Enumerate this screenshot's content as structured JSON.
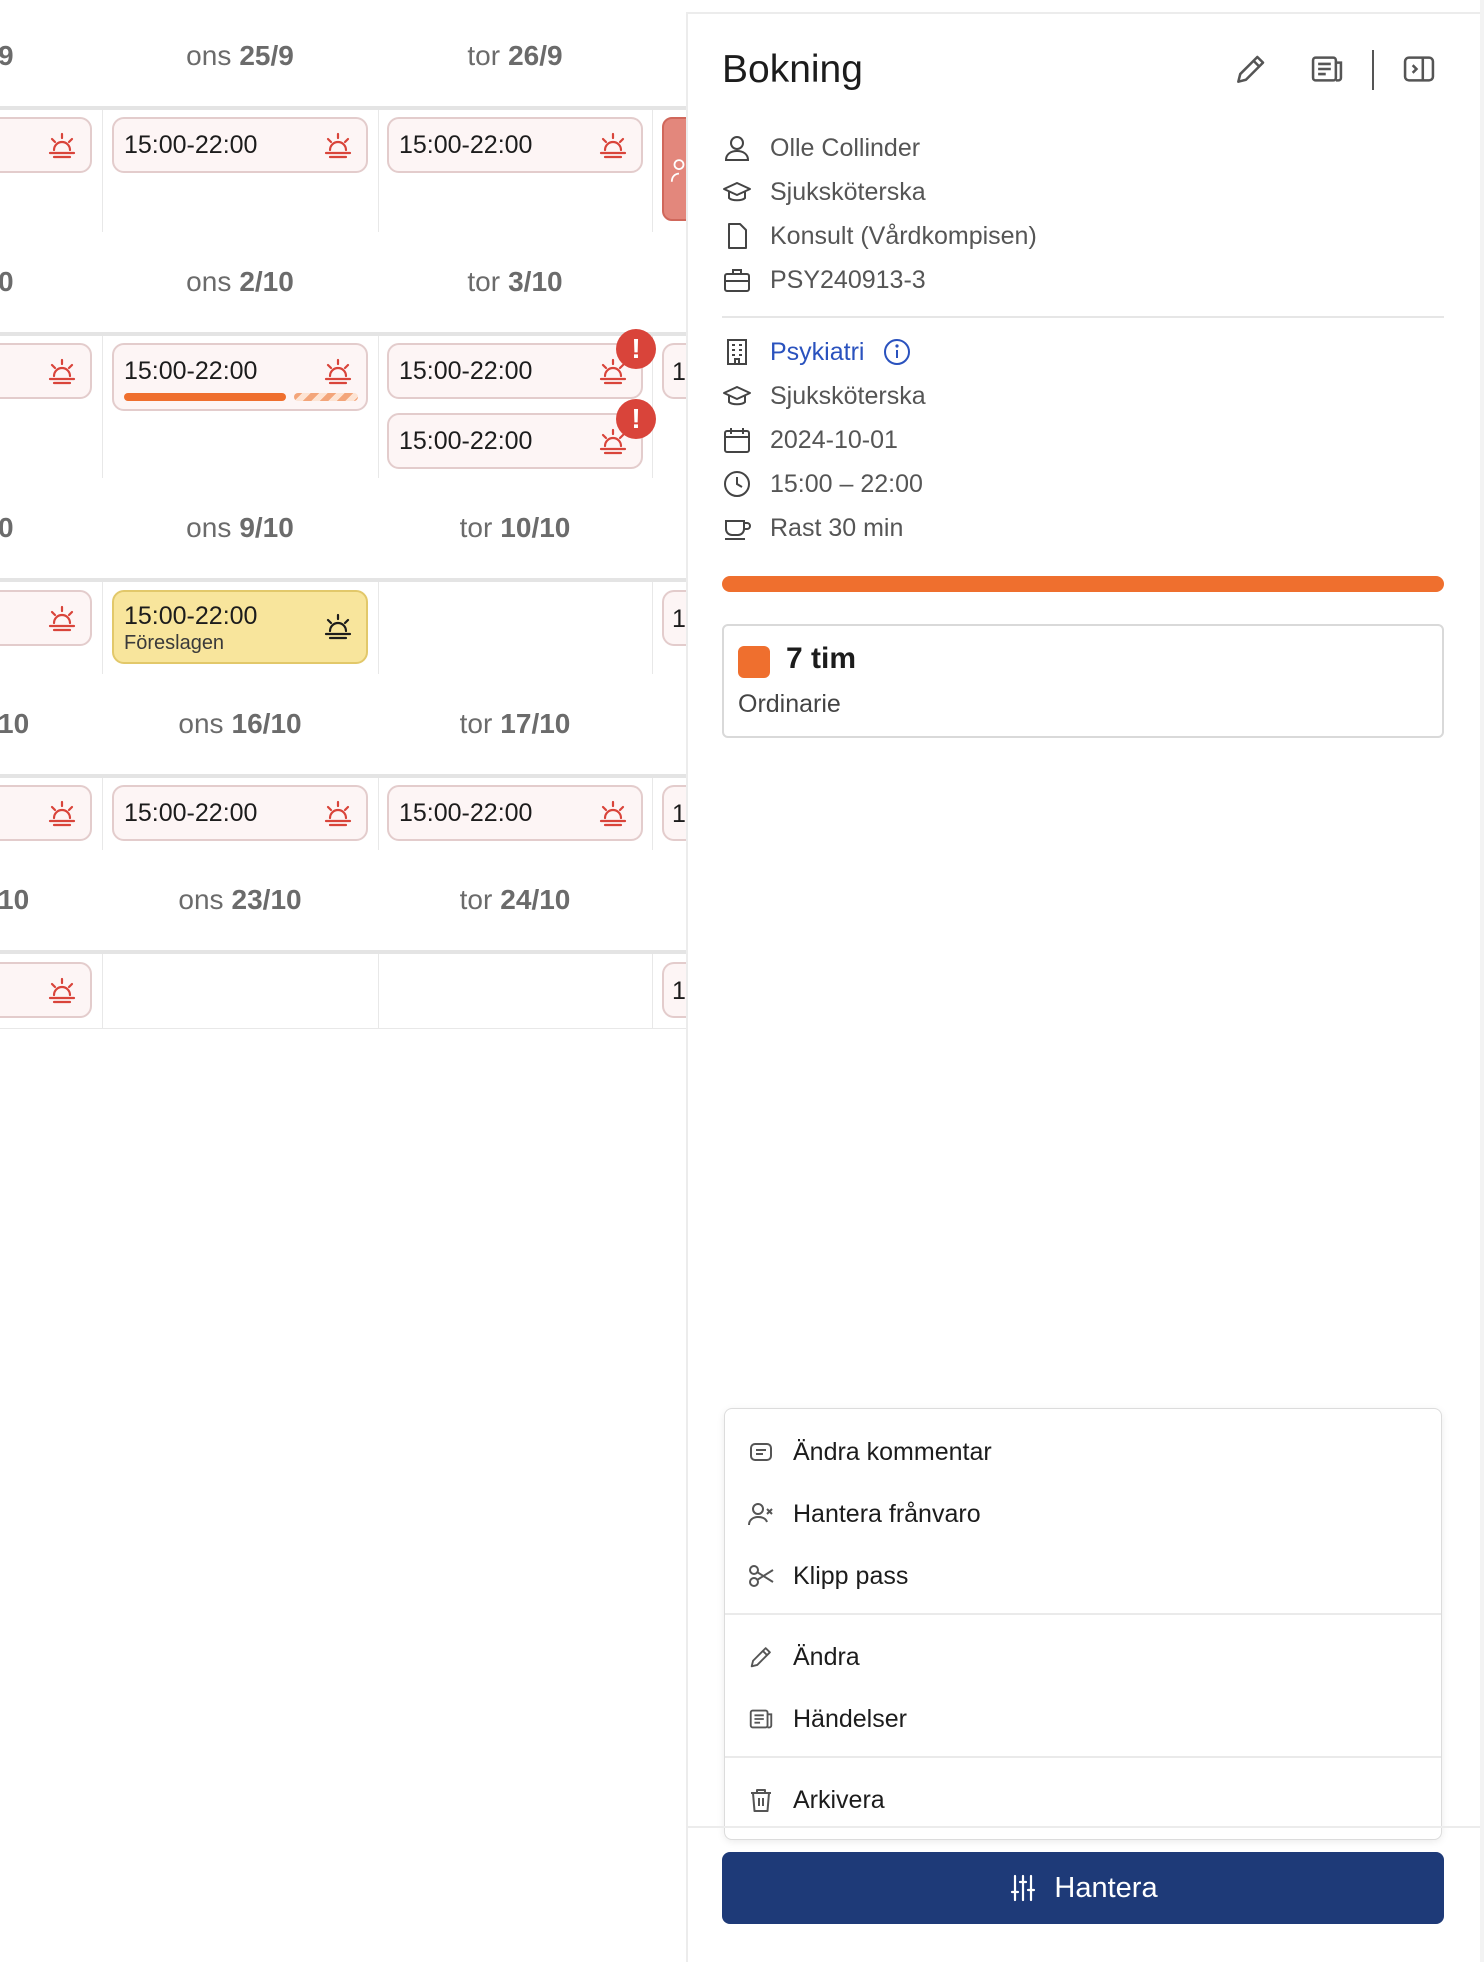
{
  "calendar": {
    "weeks": [
      {
        "prev": "9",
        "wed_label": "ons",
        "wed_date": "25/9",
        "thu_label": "tor",
        "thu_date": "26/9"
      },
      {
        "prev": "0",
        "wed_label": "ons",
        "wed_date": "2/10",
        "thu_label": "tor",
        "thu_date": "3/10"
      },
      {
        "prev": "0",
        "wed_label": "ons",
        "wed_date": "9/10",
        "thu_label": "tor",
        "thu_date": "10/10"
      },
      {
        "prev": "10",
        "wed_label": "ons",
        "wed_date": "16/10",
        "thu_label": "tor",
        "thu_date": "17/10"
      },
      {
        "prev": "10",
        "wed_label": "ons",
        "wed_date": "23/10",
        "thu_label": "tor",
        "thu_date": "24/10"
      }
    ],
    "shift_time": "15:00-22:00",
    "suggested_status": "Föreslagen",
    "alert_mark": "!",
    "partial_text": "1",
    "colors": {
      "alert": "#d9443a",
      "booked_bar": "#ef6f2e",
      "suggested_bg": "#f8e59c",
      "shift_bg": "#fdf5f5"
    }
  },
  "panel": {
    "title": "Bokning",
    "header_icons": [
      "pencil-icon",
      "events-icon",
      "collapse-panel-icon"
    ],
    "person": {
      "name": "Olle Collinder",
      "role": "Sjuksköterska",
      "contract": "Konsult (Vårdkompisen)",
      "assignment": "PSY240913-3"
    },
    "shift": {
      "unit": "Psykiatri",
      "role": "Sjuksköterska",
      "date": "2024-10-01",
      "time": "15:00 – 22:00",
      "break": "Rast 30 min"
    },
    "hours": {
      "amount": "7 tim",
      "type": "Ordinarie",
      "color": "#ef6f2e"
    },
    "menu": [
      {
        "label": "Ändra kommentar",
        "icon": "comment-icon"
      },
      {
        "label": "Hantera frånvaro",
        "icon": "user-x-icon"
      },
      {
        "label": "Klipp pass",
        "icon": "scissors-icon"
      },
      {
        "label": "Ändra",
        "icon": "pencil-icon"
      },
      {
        "label": "Händelser",
        "icon": "events-icon"
      },
      {
        "label": "Arkivera",
        "icon": "trash-icon"
      }
    ],
    "manage_button": "Hantera",
    "accent_color": "#1e3a78",
    "link_color": "#2a52be"
  }
}
